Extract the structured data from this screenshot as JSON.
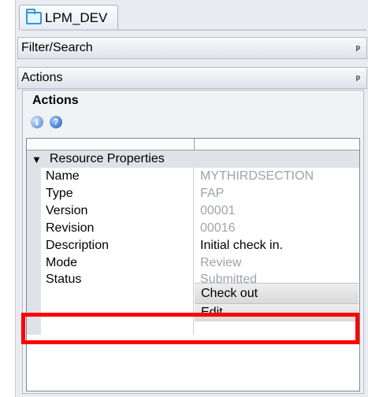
{
  "tab": {
    "label": "LPM_DEV"
  },
  "panels": {
    "filter_search": "Filter/Search",
    "actions": "Actions"
  },
  "actions_section": {
    "title": "Actions"
  },
  "property_grid": {
    "section": "Resource Properties",
    "rows": [
      {
        "name": "Name",
        "value": "MYTHIRDSECTION"
      },
      {
        "name": "Type",
        "value": "FAP"
      },
      {
        "name": "Version",
        "value": "00001"
      },
      {
        "name": "Revision",
        "value": "00016"
      },
      {
        "name": "Description",
        "value": "Initial check in."
      },
      {
        "name": "Mode",
        "value": "Review"
      },
      {
        "name": "Status",
        "value": "Submitted"
      }
    ]
  },
  "context_menu": {
    "items": [
      {
        "label": "Check out"
      },
      {
        "label": "Edit"
      }
    ]
  },
  "colors": {
    "highlight": "#ff0000",
    "accent": "#2f9ad8"
  },
  "icons": [
    "folder-icon",
    "pin-icon",
    "info-icon",
    "help-icon",
    "expand-icon"
  ]
}
